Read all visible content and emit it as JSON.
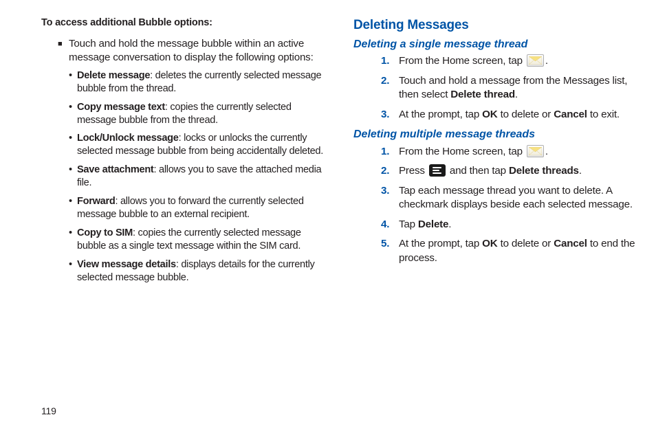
{
  "page_number": "119",
  "left": {
    "intro": "To access additional Bubble options:",
    "square_item": "Touch and hold the message bubble within an active message conversation to display the following options:",
    "bullets": [
      {
        "bold": "Delete message",
        "rest": ": deletes the currently selected message bubble from the thread."
      },
      {
        "bold": "Copy message text",
        "rest": ": copies the currently selected message bubble from the thread."
      },
      {
        "bold": "Lock/Unlock message",
        "rest": ": locks or unlocks the currently selected message bubble from being accidentally deleted."
      },
      {
        "bold": "Save attachment",
        "rest": ": allows you to save the attached media file."
      },
      {
        "bold": "Forward",
        "rest": ": allows you to forward the currently selected message bubble to an external recipient."
      },
      {
        "bold": "Copy to SIM",
        "rest": ": copies the currently selected message bubble as a single text message within the SIM card."
      },
      {
        "bold": "View message details",
        "rest": ": displays details for the currently selected message bubble."
      }
    ]
  },
  "right": {
    "h1": "Deleting Messages",
    "sec1": {
      "h2": "Deleting a single message thread",
      "step1_pre": "From the Home screen, tap ",
      "step1_post": ".",
      "step2_pre": "Touch and hold a message from the Messages list, then select ",
      "step2_bold": "Delete thread",
      "step2_post": ".",
      "step3_pre": "At the prompt, tap ",
      "step3_b1": "OK",
      "step3_mid": " to delete or ",
      "step3_b2": "Cancel",
      "step3_post": " to exit."
    },
    "sec2": {
      "h2": "Deleting multiple message threads",
      "step1_pre": "From the Home screen, tap ",
      "step1_post": ".",
      "step2_pre": "Press ",
      "step2_mid": " and then tap ",
      "step2_bold": "Delete threads",
      "step2_post": ".",
      "step3": "Tap each message thread you want to delete. A checkmark displays beside each selected message.",
      "step4_pre": "Tap ",
      "step4_bold": "Delete",
      "step4_post": ".",
      "step5_pre": "At the prompt, tap ",
      "step5_b1": "OK",
      "step5_mid": " to delete or ",
      "step5_b2": "Cancel",
      "step5_post": " to end the process."
    }
  }
}
